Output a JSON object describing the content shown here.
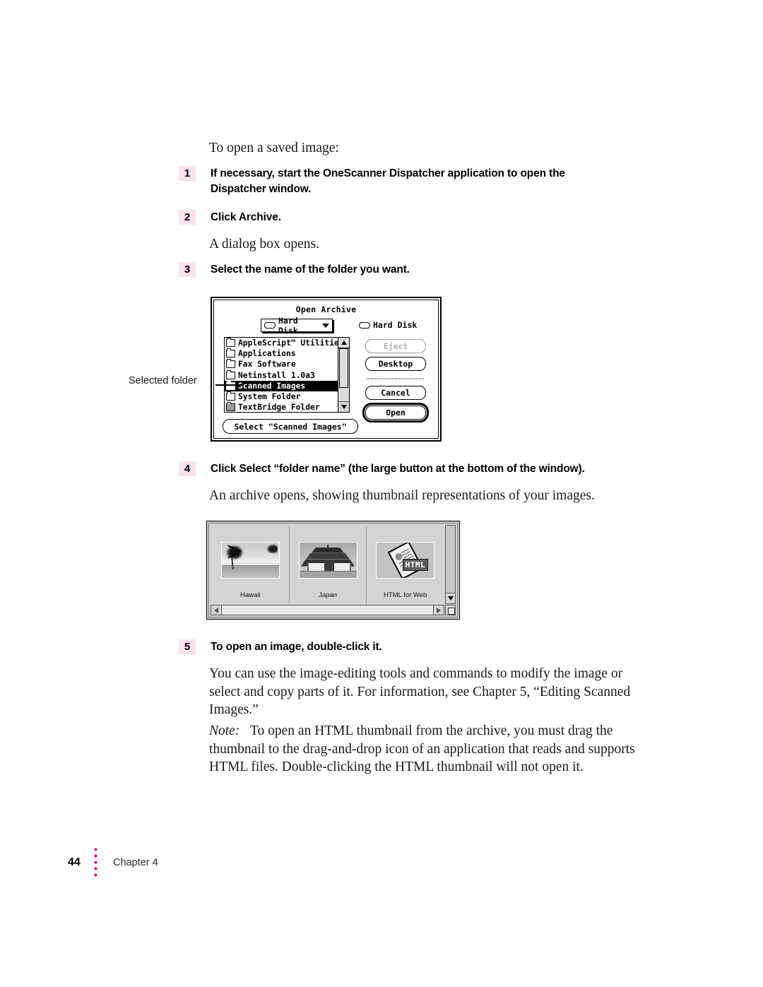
{
  "document": {
    "intro": "To open a saved image:",
    "steps": [
      {
        "num": "1",
        "text": "If necessary, start the OneScanner Dispatcher application to open the Dispatcher window."
      },
      {
        "num": "2",
        "text": "Click Archive."
      },
      {
        "num": "3",
        "text": "Select the name of the folder you want."
      },
      {
        "num": "4",
        "text": "Click Select “folder name” (the large button at the bottom of the window)."
      },
      {
        "num": "5",
        "text": "To open an image, double-click it."
      }
    ],
    "paragraphs": {
      "after_step2": "A dialog box opens.",
      "after_step4": "An archive opens, showing thumbnail representations of your images.",
      "after_step5": "You can use the image-editing tools and commands to modify the image or select and copy parts of it. For information, see Chapter 5, “Editing Scanned Images.”",
      "note_label": "Note:",
      "note_body": "To open an HTML thumbnail from the archive, you must drag the thumbnail to the drag-and-drop icon of an application that reads and supports HTML files. Double-clicking the HTML thumbnail will not open it."
    },
    "callout": {
      "selected_folder": "Selected folder"
    },
    "footer": {
      "page_number": "44",
      "chapter": "Chapter 4",
      "dot_color": "#e6007e"
    },
    "accent_colors": {
      "step_number_background": "#fbe2ef",
      "footer_dots": "#e6007e"
    }
  },
  "open_archive_dialog": {
    "title": "Open Archive",
    "volume_popup": {
      "label": "Hard Disk",
      "icon": "disk-icon",
      "chevron": "chevron-down-icon"
    },
    "current_volume": {
      "label": "Hard Disk",
      "icon": "disk-icon"
    },
    "file_list": [
      {
        "name": "AppleScript™ Utilities",
        "selected": false,
        "icon": "folder-icon"
      },
      {
        "name": "Applications",
        "selected": false,
        "icon": "folder-icon"
      },
      {
        "name": "Faх Software",
        "selected": false,
        "icon": "folder-icon"
      },
      {
        "name": "Netinstall 1.0a3",
        "selected": false,
        "icon": "folder-icon"
      },
      {
        "name": "Scanned Images",
        "selected": true,
        "icon": "folder-icon"
      },
      {
        "name": "System Folder",
        "selected": false,
        "icon": "folder-icon"
      },
      {
        "name": "TextBridge Folder",
        "selected": false,
        "icon": "folder-icon"
      }
    ],
    "buttons": {
      "eject": "Eject",
      "eject_enabled": false,
      "desktop": "Desktop",
      "cancel": "Cancel",
      "open": "Open",
      "open_is_default": true,
      "select_folder": "Select \"Scanned Images\""
    }
  },
  "archive_window": {
    "thumbnails": [
      {
        "caption": "Hawaii",
        "kind": "photo-beach"
      },
      {
        "caption": "Japan",
        "kind": "photo-temple"
      },
      {
        "caption": "HTML for Web",
        "kind": "html-document",
        "badge": "HTML"
      }
    ],
    "scrollbars": {
      "vertical": "vertical-scrollbar",
      "horizontal": "horizontal-scrollbar",
      "grow_box": "grow-box"
    }
  }
}
